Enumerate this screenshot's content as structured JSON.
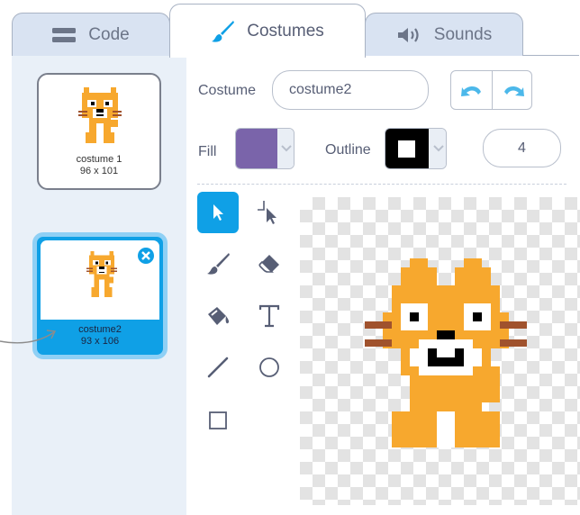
{
  "tabs": [
    {
      "label": "Code",
      "icon": "code-blocks-icon"
    },
    {
      "label": "Costumes",
      "icon": "paintbrush-icon"
    },
    {
      "label": "Sounds",
      "icon": "speaker-icon"
    }
  ],
  "costumes": [
    {
      "name": "costume 1",
      "size": "96 x 101",
      "selected": false
    },
    {
      "name": "costume2",
      "size": "93 x 106",
      "selected": true
    }
  ],
  "editor": {
    "costume_label": "Costume",
    "costume_name": "costume2",
    "fill_label": "Fill",
    "fill_color": "#7a64aa",
    "outline_label": "Outline",
    "outline_color": "#000000",
    "outline_width": "4"
  },
  "tools": [
    "select-tool-icon",
    "reshape-tool-icon",
    "brush-tool-icon",
    "eraser-tool-icon",
    "fill-tool-icon",
    "text-tool-icon",
    "line-tool-icon",
    "circle-tool-icon",
    "rectangle-tool-icon"
  ],
  "colors": {
    "accent": "#0fa0e6",
    "cat_orange": "#f7a82e",
    "panel_bg": "#e9f0f8"
  }
}
